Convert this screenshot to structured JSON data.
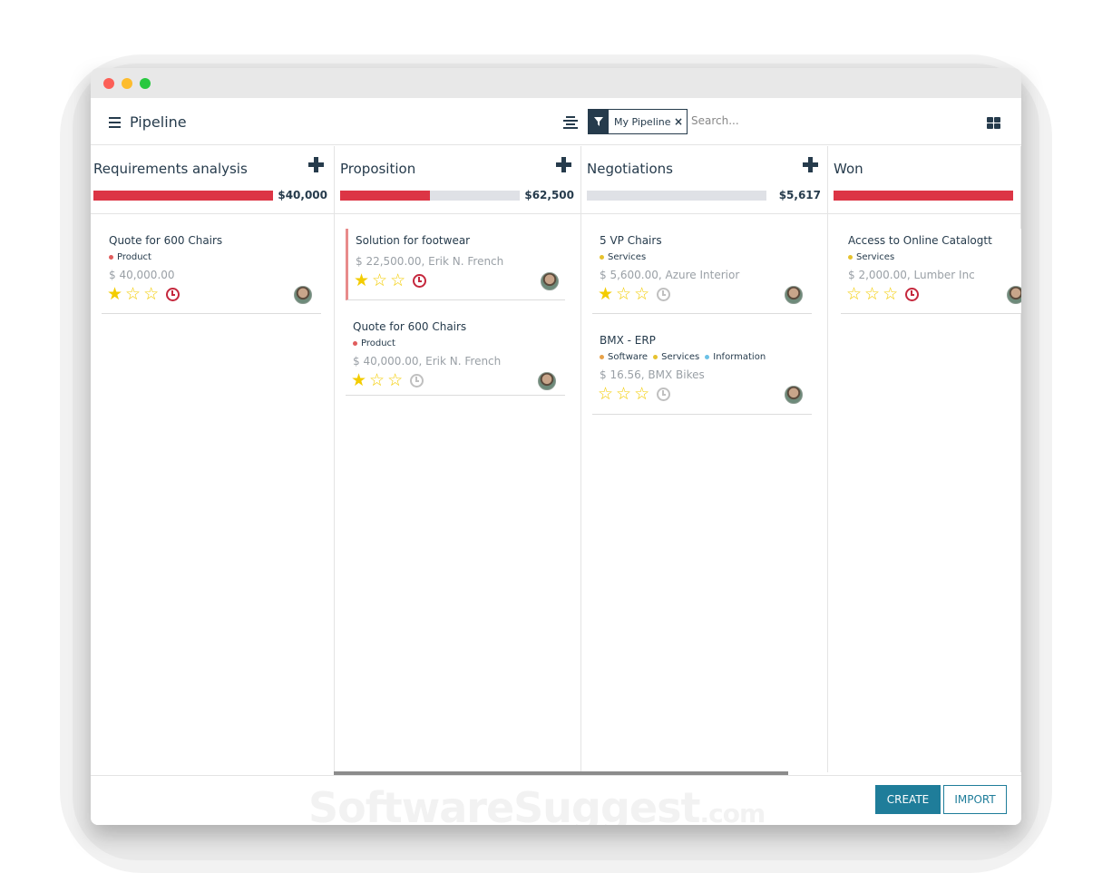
{
  "app": {
    "title": "Pipeline"
  },
  "search": {
    "facet_label": "My Pipeline",
    "facet_close": "×",
    "placeholder": "Search..."
  },
  "colors": {
    "accent": "#263b4c",
    "danger": "#dc3545",
    "primary": "#1f7d9a",
    "star": "#f3cc00"
  },
  "columns": [
    {
      "title": "Requirements analysis",
      "total": "$40,000",
      "progress": 1.0,
      "cards": [
        {
          "title": "Quote for 600 Chairs",
          "tags": [
            {
              "name": "Product",
              "color": "#e05d5d"
            }
          ],
          "subtitle": "$ 40,000.00",
          "stars": 1,
          "activity": "late"
        }
      ]
    },
    {
      "title": "Proposition",
      "total": "$62,500",
      "progress": 0.5,
      "cards": [
        {
          "title": "Solution for footwear",
          "tags": [],
          "subtitle": "$ 22,500.00, Erik N. French",
          "stars": 1,
          "activity": "late"
        },
        {
          "title": "Quote for 600 Chairs",
          "tags": [
            {
              "name": "Product",
              "color": "#e05d5d"
            }
          ],
          "subtitle": "$ 40,000.00, Erik N. French",
          "stars": 1,
          "activity": "normal"
        }
      ]
    },
    {
      "title": "Negotiations",
      "total": "$5,617",
      "progress": 0.0,
      "cards": [
        {
          "title": "5 VP Chairs",
          "tags": [
            {
              "name": "Services",
              "color": "#e6c22f"
            }
          ],
          "subtitle": "$ 5,600.00, Azure Interior",
          "stars": 1,
          "activity": "normal"
        },
        {
          "title": "BMX - ERP",
          "tags": [
            {
              "name": "Software",
              "color": "#e8a24a"
            },
            {
              "name": "Services",
              "color": "#e6c22f"
            },
            {
              "name": "Information",
              "color": "#6cc1e6"
            }
          ],
          "subtitle": "$ 16.56, BMX Bikes",
          "stars": 0,
          "activity": "normal"
        }
      ]
    },
    {
      "title": "Won",
      "total": "",
      "progress": 1.0,
      "cards": [
        {
          "title": "Access to Online Catalogtt",
          "tags": [
            {
              "name": "Services",
              "color": "#e6c22f"
            }
          ],
          "subtitle": "$ 2,000.00, Lumber Inc",
          "stars": 0,
          "activity": "late"
        }
      ]
    }
  ],
  "footer": {
    "create_label": "CREATE",
    "import_label": "IMPORT",
    "watermark": "SoftwareSuggest",
    "watermark_suffix": ".com"
  }
}
